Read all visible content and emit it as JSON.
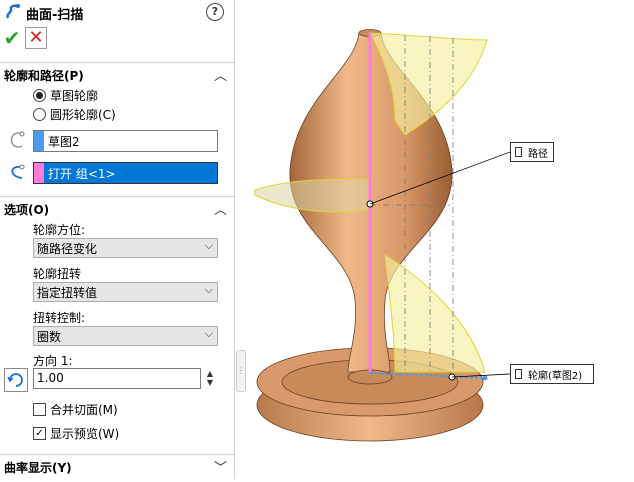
{
  "panel": {
    "title": "曲面-扫描",
    "help_icon": "?",
    "ok_icon": "checkmark-icon",
    "cancel_icon": "x-icon"
  },
  "profile_path": {
    "header": "轮廓和路径(P)",
    "radio_sketch": "草图轮廓",
    "radio_circle": "圆形轮廓(C)",
    "profile_value": "草图2",
    "path_value": "打开 组<1>"
  },
  "options": {
    "header": "选项(O)",
    "orientation_label": "轮廓方位:",
    "orientation_value": "随路径变化",
    "twist_label": "轮廓扭转",
    "twist_value": "指定扭转值",
    "twist_control_label": "扭转控制:",
    "twist_control_value": "圈数",
    "direction_label": "方向 1:",
    "direction_value": "1.00",
    "merge_faces_label": "合并切面(M)",
    "show_preview_label": "显示预览(W)",
    "show_preview_checked": "✓"
  },
  "curvature": {
    "header": "曲率显示(Y)"
  },
  "viewport": {
    "callout_path": "路径",
    "callout_profile": "轮廓(草图2)"
  },
  "colors": {
    "ok": "#28a22a",
    "cancel": "#d42020",
    "selection": "#0078d7",
    "profile_swatch": "#4a9bf0",
    "path_swatch": "#ff7ad9",
    "vase": "#d9996a",
    "sweep_surface": "#f5f0a0"
  }
}
